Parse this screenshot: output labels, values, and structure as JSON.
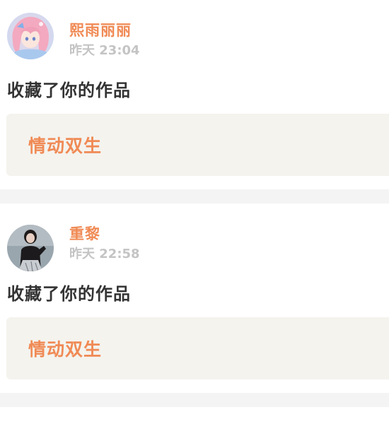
{
  "notifications": [
    {
      "user_name": "熙雨丽丽",
      "timestamp": "昨天 23:04",
      "action": "收藏了你的作品",
      "work_title": "情动双生",
      "avatar_icon": "anime-girl-avatar-icon"
    },
    {
      "user_name": "重黎",
      "timestamp": "昨天 22:58",
      "action": "收藏了你的作品",
      "work_title": "情动双生",
      "avatar_icon": "woman-portrait-avatar-icon"
    }
  ],
  "colors": {
    "accent": "#f08a55",
    "card_bg": "#f4f3ee",
    "separator": "#f4f4f4",
    "timestamp": "#c4c4c4",
    "text": "#333333"
  }
}
